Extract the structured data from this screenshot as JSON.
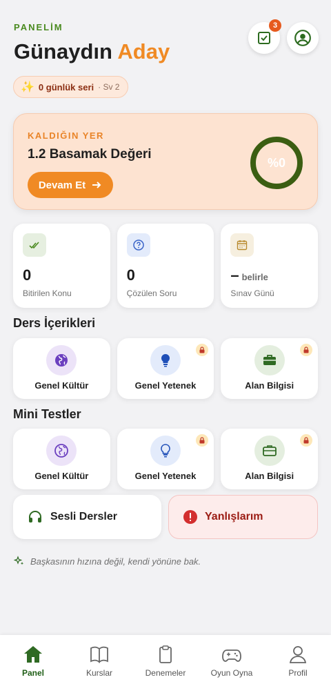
{
  "header": {
    "kicker": "PANELİM",
    "greeting": "Günaydın",
    "name": "Aday",
    "task_count": "3"
  },
  "streak": {
    "label": "0 günlük seri",
    "level": "· Sv 2"
  },
  "resume": {
    "label": "KALDIĞIN YER",
    "title": "1.2 Basamak Değeri",
    "button": "Devam Et",
    "progress_text": "%0",
    "progress": 0
  },
  "stats": [
    {
      "value": "0",
      "unit": "",
      "caption": "Bitirilen Konu",
      "icon": "double-check-icon"
    },
    {
      "value": "0",
      "unit": "",
      "caption": "Çözülen Soru",
      "icon": "question-icon"
    },
    {
      "value": "–",
      "unit": "belirle",
      "caption": "Sınav Günü",
      "icon": "calendar-icon"
    }
  ],
  "courses": {
    "title": "Ders İçerikleri",
    "items": [
      {
        "label": "Genel Kültür",
        "icon": "globe-icon",
        "locked": false
      },
      {
        "label": "Genel Yetenek",
        "icon": "lightbulb-icon",
        "locked": true
      },
      {
        "label": "Alan Bilgisi",
        "icon": "briefcase-icon",
        "locked": true
      }
    ]
  },
  "tests": {
    "title": "Mini Testler",
    "items": [
      {
        "label": "Genel Kültür",
        "icon": "globe-icon",
        "locked": false
      },
      {
        "label": "Genel Yetenek",
        "icon": "lightbulb-icon",
        "locked": true
      },
      {
        "label": "Alan Bilgisi",
        "icon": "briefcase-icon",
        "locked": true
      }
    ]
  },
  "actions": {
    "audio": "Sesli Dersler",
    "mistakes": "Yanlışlarım"
  },
  "quote": "Başkasının hızına değil, kendi yönüne bak.",
  "tabs": [
    {
      "label": "Panel",
      "icon": "home-icon",
      "active": true
    },
    {
      "label": "Kurslar",
      "icon": "book-icon",
      "active": false
    },
    {
      "label": "Denemeler",
      "icon": "clipboard-icon",
      "active": false
    },
    {
      "label": "Oyun Oyna",
      "icon": "gamepad-icon",
      "active": false
    },
    {
      "label": "Profil",
      "icon": "user-icon",
      "active": false
    }
  ],
  "colors": {
    "accent": "#f08a24",
    "brand": "#4a8a1f",
    "active_tab": "#1f5e16",
    "danger": "#d32f2f"
  }
}
